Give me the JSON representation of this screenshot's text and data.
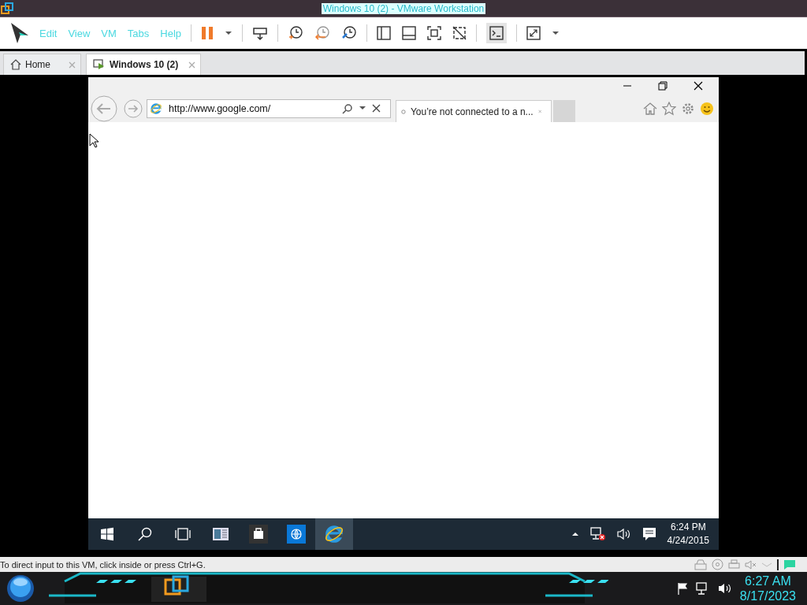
{
  "window": {
    "title": "Windows 10 (2) - VMware Workstation"
  },
  "menu": [
    {
      "label": "Edit"
    },
    {
      "label": "View"
    },
    {
      "label": "VM"
    },
    {
      "label": "Tabs"
    },
    {
      "label": "Help"
    }
  ],
  "tabs": [
    {
      "label": "Home",
      "selected": false
    },
    {
      "label": "Windows 10 (2)",
      "selected": true
    }
  ],
  "browser": {
    "address": "http://www.google.com/",
    "tab": "You’re not connected to a n..."
  },
  "guest_taskbar": {
    "apps": [
      {
        "kind": "start",
        "selected": false
      },
      {
        "kind": "search",
        "selected": false
      },
      {
        "kind": "taskview",
        "selected": false
      },
      {
        "kind": "news",
        "selected": false
      },
      {
        "kind": "store",
        "selected": false
      },
      {
        "kind": "globe",
        "selected": false
      },
      {
        "kind": "ie",
        "selected": true
      }
    ],
    "time": "6:24 PM",
    "date": "4/24/2015"
  },
  "status_bar": {
    "text": "To direct input to this VM, click inside or press Ctrl+G."
  },
  "host_taskbar": {
    "time": "6:27 AM",
    "date": "8/17/2023"
  }
}
